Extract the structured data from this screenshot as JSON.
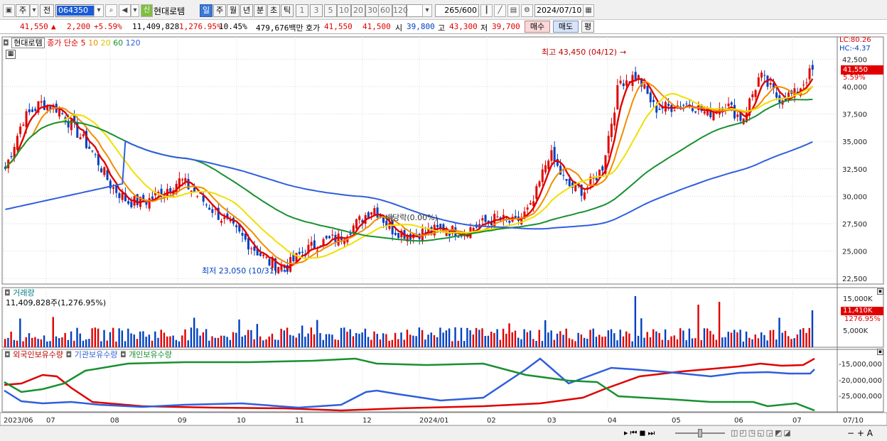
{
  "toolbar": {
    "type": "주",
    "prev": "전",
    "code": "064350",
    "name": "현대로템",
    "tabs": [
      "일",
      "주",
      "월",
      "년",
      "분",
      "초",
      "틱"
    ],
    "periods": [
      "1",
      "3",
      "5",
      "10",
      "20",
      "30",
      "60",
      "120"
    ],
    "count": "265",
    "max": "/600",
    "date": "2024/07/10"
  },
  "quote": {
    "price": "41,550",
    "arrow": "▲",
    "change": "2,200",
    "pct": "+5.59%",
    "volume": "11,409,828",
    "vol_pct": "1,276.95%",
    "turnover": "10.45%",
    "amount": "479,676백만",
    "ask_label": "호가",
    "ask": "41,550",
    "bid": "41,500",
    "open_label": "시",
    "open": "39,800",
    "high_label": "고",
    "high": "43,300",
    "low_label": "저",
    "low": "39,700",
    "buy": "매수",
    "sell": "매도",
    "eval": "평"
  },
  "price_panel": {
    "name": "현대로템",
    "legend_prefix": "종가 단순",
    "ma": [
      "5",
      "10",
      "20",
      "60",
      "120"
    ],
    "axis": [
      "42,500",
      "40,000",
      "37,500",
      "35,000",
      "32,500",
      "30,000",
      "27,500",
      "25,000",
      "22,500"
    ],
    "lc": "LC:80.26",
    "hc": "HC:-4.37",
    "cur": "41,550",
    "cur_pct": "5.59%",
    "max_note": "최고 43,450 (04/12)",
    "min_note": "최저 23,050 (10/31)",
    "div_note": "배당락(0.00%)"
  },
  "volume_panel": {
    "title": "거래량",
    "value": "11,409,828주(1,276.95%)",
    "axis": [
      "15,000K",
      "5,000K"
    ],
    "cur": "11,410K",
    "cur_pct": "1276.95%"
  },
  "holding_panel": {
    "series": [
      "외국인보유수량",
      "기관보유수량",
      "개인보유수량"
    ],
    "axis": [
      "-15,000,000",
      "-20,000,000",
      "-25,000,000"
    ]
  },
  "xaxis": [
    "2023/06",
    "07",
    "08",
    "09",
    "10",
    "11",
    "12",
    "2024/01",
    "02",
    "03",
    "04",
    "05",
    "06",
    "07",
    "07/10"
  ],
  "colors": {
    "ma5": "#e00000",
    "ma10": "#f08c00",
    "ma20": "#f0e000",
    "ma60": "#189030",
    "ma120": "#2f5fdc",
    "up": "#e00000",
    "down": "#0040c0"
  },
  "chart_data": {
    "type": "candlestick",
    "xlabels": [
      "2023/06",
      "07",
      "08",
      "09",
      "10",
      "11",
      "12",
      "2024/01",
      "02",
      "03",
      "04",
      "05",
      "06",
      "07"
    ],
    "closes": [
      32500,
      37000,
      38500,
      38000,
      36000,
      34000,
      31000,
      29500,
      29500,
      30500,
      31500,
      30000,
      28500,
      27000,
      25500,
      24000,
      23500,
      25000,
      25800,
      26200,
      27500,
      29000,
      27000,
      26500,
      26800,
      27000,
      26700,
      27400,
      28000,
      27500,
      29000,
      34000,
      31000,
      30500,
      32500,
      40500,
      41000,
      38000,
      38200,
      38500,
      37500,
      38500,
      37000,
      41000,
      39000,
      39300,
      41550
    ],
    "lows": {
      "min": 23050,
      "min_label": "10/31"
    },
    "highs": {
      "max": 43450,
      "max_label": "04/12"
    }
  }
}
